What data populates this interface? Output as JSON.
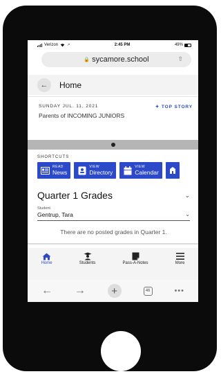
{
  "status_bar": {
    "carrier": "Verizon",
    "time": "2:45 PM",
    "battery": "49%"
  },
  "browser": {
    "url": "sycamore.school",
    "tab_count": "46"
  },
  "header": {
    "title": "Home"
  },
  "top_story": {
    "date": "SUNDAY JUL. 11, 2021",
    "badge": "TOP STORY",
    "headline": "Parents of INCOMING JUNIORS"
  },
  "shortcuts": {
    "label": "SHORTCUTS",
    "items": [
      {
        "small": "READ",
        "big": "News",
        "icon": "newspaper-icon"
      },
      {
        "small": "VIEW",
        "big": "Directory",
        "icon": "contact-card-icon"
      },
      {
        "small": "VIEW",
        "big": "Calendar",
        "icon": "calendar-icon"
      }
    ]
  },
  "grades": {
    "title": "Quarter 1 Grades",
    "student_label": "Student",
    "student_value": "Gentrup, Tara",
    "empty_message": "There are no posted grades in Quarter 1."
  },
  "bottom_nav": {
    "items": [
      {
        "label": "Home",
        "icon": "home-icon",
        "active": true
      },
      {
        "label": "Students",
        "icon": "student-icon",
        "active": false
      },
      {
        "label": "Pass-A-Notes",
        "icon": "note-icon",
        "active": false
      },
      {
        "label": "More",
        "icon": "menu-icon",
        "active": false
      }
    ]
  },
  "colors": {
    "accent": "#2c49c9",
    "frame": "#0b0b0b"
  }
}
